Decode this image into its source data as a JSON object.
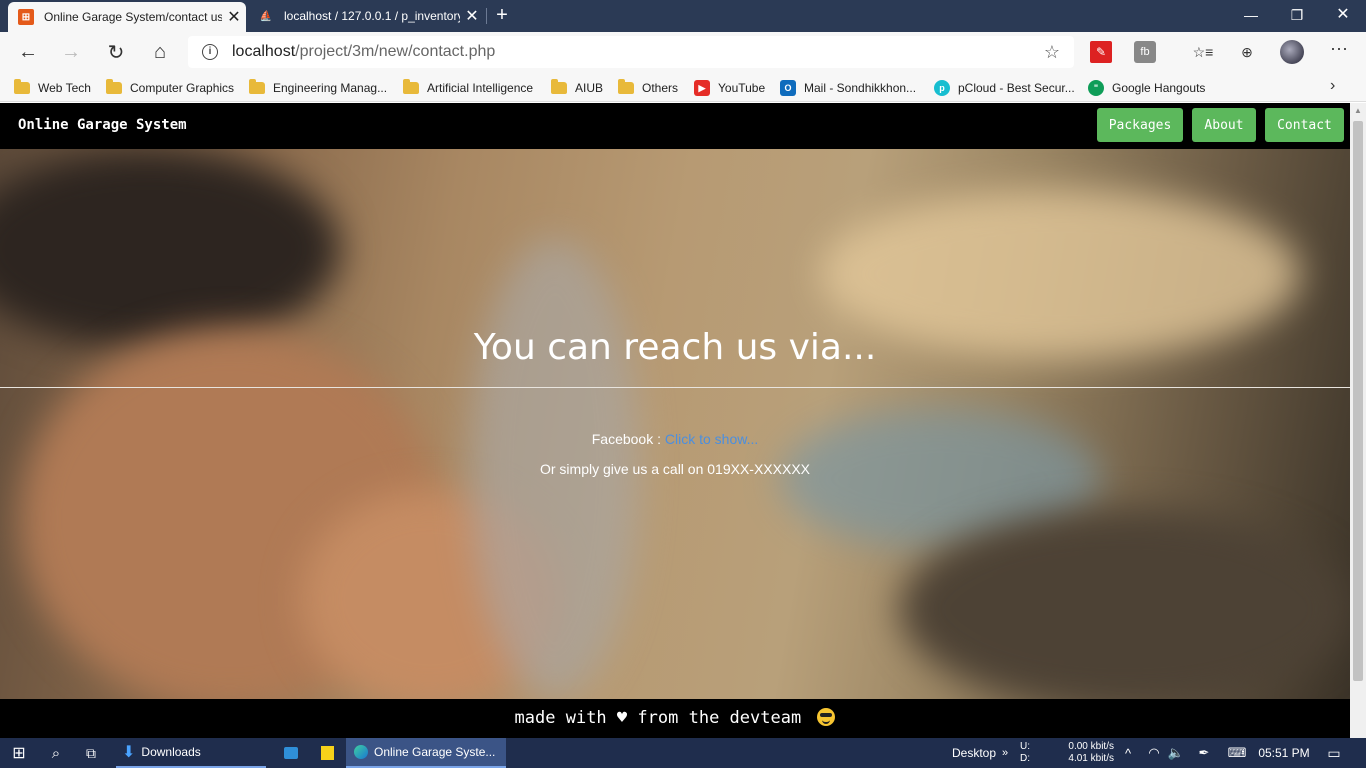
{
  "browser": {
    "tabs": [
      {
        "title": "Online Garage System/contact us",
        "active": true
      },
      {
        "title": "localhost / 127.0.0.1 / p_inventory",
        "active": false
      }
    ],
    "new_tab_label": "+",
    "address": {
      "host": "localhost",
      "path": "/project/3m/new/contact.php"
    },
    "bookmarks": [
      {
        "label": "Web Tech",
        "icon": "folder-icon"
      },
      {
        "label": "Computer Graphics",
        "icon": "folder-icon"
      },
      {
        "label": "Engineering Manag...",
        "icon": "folder-icon"
      },
      {
        "label": "Artificial Intelligence",
        "icon": "folder-icon"
      },
      {
        "label": "AIUB",
        "icon": "folder-icon"
      },
      {
        "label": "Others",
        "icon": "folder-icon"
      },
      {
        "label": "YouTube",
        "icon": "youtube-icon"
      },
      {
        "label": "Mail - Sondhikkhon...",
        "icon": "outlook-icon"
      },
      {
        "label": "pCloud - Best Secur...",
        "icon": "pcloud-icon"
      },
      {
        "label": "Google Hangouts",
        "icon": "hangouts-icon"
      }
    ]
  },
  "site": {
    "brand": "Online Garage System",
    "nav": {
      "packages": "Packages",
      "about": "About",
      "contact": "Contact"
    },
    "hero": {
      "title": "You can reach us via...",
      "facebook_label": "Facebook :",
      "facebook_link": "Click to show...",
      "call_text": "Or simply give us a call on 019XX-XXXXXX"
    },
    "footer": {
      "before": "made with",
      "heart": "♥",
      "after": "from the devteam"
    }
  },
  "taskbar": {
    "downloads": "Downloads",
    "edge_window": "Online Garage Syste...",
    "desktop": "Desktop",
    "upload_label": "U:",
    "download_label": "D:",
    "upload_speed": "0.00 kbit/s",
    "download_speed": "4.01 kbit/s",
    "clock": "05:51 PM"
  },
  "colors": {
    "nav_button": "#5cb85c",
    "link": "#4a8fe0",
    "tabstrip": "#2b3a55",
    "taskbar": "#1f2d4d"
  }
}
